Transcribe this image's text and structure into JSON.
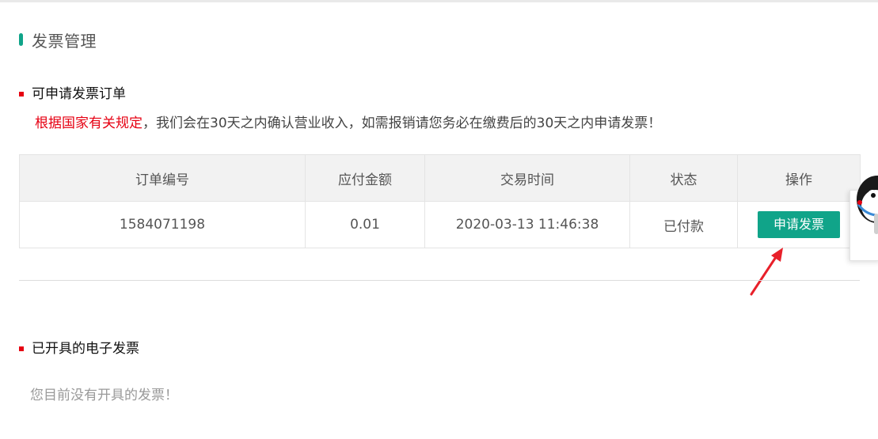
{
  "page": {
    "title": "发票管理"
  },
  "pending_section": {
    "title": "可申请发票订单",
    "notice_red": "根据国家有关规定",
    "notice_rest": "，我们会在30天之内确认营业收入，如需报销请您务必在缴费后的30天之内申请发票！",
    "table": {
      "headers": [
        "订单编号",
        "应付金额",
        "交易时间",
        "状态",
        "操作"
      ],
      "rows": [
        {
          "order_id": "1584071198",
          "amount": "0.01",
          "time": "2020-03-13 11:46:38",
          "status": "已付款",
          "action_label": "申请发票"
        }
      ]
    }
  },
  "issued_section": {
    "title": "已开具的电子发票",
    "empty_message": "您目前没有开具的发票！"
  },
  "colors": {
    "accent": "#10a489",
    "marker_red": "#e60012"
  },
  "icons": {
    "annotation_arrow": "red-arrow-icon",
    "mascot": "mascot-icon"
  }
}
